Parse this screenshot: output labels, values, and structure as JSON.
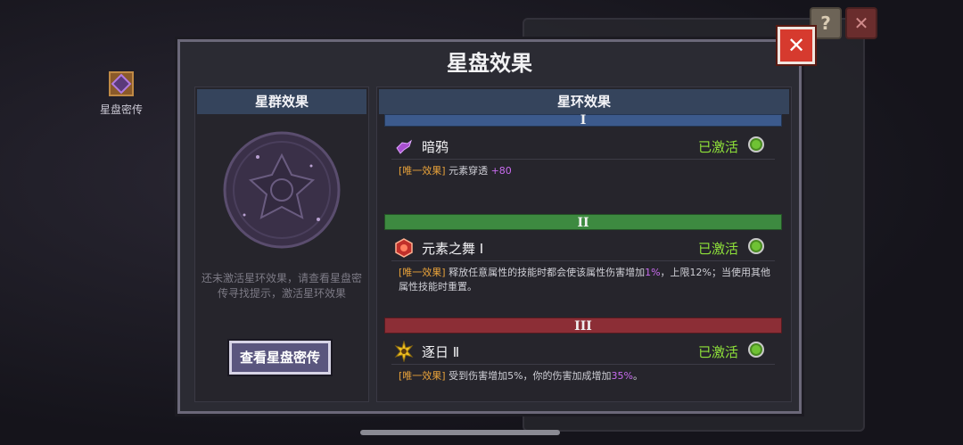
{
  "background": {
    "icon_label": "星盘密传"
  },
  "corner": {
    "help_label": "?",
    "close_label": "✕"
  },
  "dialog": {
    "title": "星盘效果",
    "close_label": "✕"
  },
  "left_panel": {
    "header": "星群效果",
    "hint": "还未激活星环效果，请查看星盘密传寻找提示，激活星环效果",
    "button_label": "查看星盘密传"
  },
  "right_panel": {
    "header": "星环效果",
    "rings": [
      {
        "numeral": "I",
        "color": "#3c5a8c",
        "effect_name": "暗鸦",
        "status": "已激活",
        "icon": "crow-icon",
        "desc_tag": "[唯一效果]",
        "desc_text": "元素穿透",
        "desc_value": "+80"
      },
      {
        "numeral": "II",
        "color": "#3d8a40",
        "effect_name": "元素之舞 Ⅰ",
        "status": "已激活",
        "icon": "element-dance-icon",
        "desc_tag": "[唯一效果]",
        "desc_text_1": "释放任意属性的技能时都会使该属性伤害增加",
        "desc_value_1": "1%",
        "desc_text_2": "，上限12%；当使用其他属性技能时重置。"
      },
      {
        "numeral": "III",
        "color": "#8c2e36",
        "effect_name": "逐日 Ⅱ",
        "status": "已激活",
        "icon": "sun-chase-icon",
        "desc_tag": "[唯一效果]",
        "desc_text_1": "受到伤害增加5%，你的伤害加成增加",
        "desc_value_1": "35%",
        "desc_text_2": "。"
      }
    ]
  },
  "colors": {
    "status_active": "#8fe23a",
    "tag": "#e8a23a",
    "highlight": "#c96cf0",
    "close_button": "#d63a2e"
  }
}
